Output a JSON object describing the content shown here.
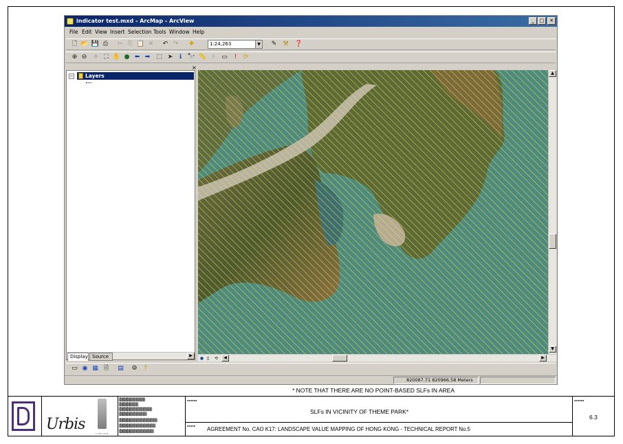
{
  "window": {
    "title": "indicator test.mxd - ArcMap - ArcView",
    "controls": [
      "_",
      "□",
      "✕"
    ]
  },
  "menu": [
    "File",
    "Edit",
    "View",
    "Insert",
    "Selection",
    "Tools",
    "Window",
    "Help"
  ],
  "toolbar_standard": {
    "icons": [
      "new-icon",
      "open-icon",
      "save-icon",
      "print-icon",
      "cut-icon",
      "copy-icon",
      "paste-icon",
      "delete-icon",
      "undo-icon",
      "redo-icon",
      "add-data-icon"
    ],
    "scale_value": "1:24,263",
    "extra_icons": [
      "editor-icon",
      "arctoolbox-icon",
      "whats-this-icon"
    ]
  },
  "toolbar_tools": {
    "icons": [
      "zoom-in-icon",
      "zoom-out-icon",
      "fixed-zoom-in-icon",
      "fixed-zoom-out-icon",
      "pan-icon",
      "full-extent-icon",
      "back-icon",
      "forward-icon",
      "select-features-icon",
      "select-elements-icon",
      "identify-icon",
      "find-icon",
      "measure-icon",
      "hyperlink-icon",
      "go-to-xy-icon",
      "alert-icon",
      "refresh-icon"
    ]
  },
  "toc": {
    "layers_label": "Layers",
    "tabs": [
      "Display",
      "Source"
    ]
  },
  "map": {
    "water_color": "#4e8b7c",
    "hatch_color": "#e6e060"
  },
  "status": {
    "coordinates": "820087.71  820966.58 Meters"
  },
  "note": "* NOTE THAT THERE ARE NO POINT-BASED SLFs IN AREA",
  "title_block": {
    "logo_text": "Urbis",
    "drawing_title": "SLFs IN VICINITY OF THEME PARK*",
    "agreement": "AGREEMENT No. CAO K17: LANDSCAPE VALUE MAPPING OF HONG KONG - TECHNICAL REPORT No.5",
    "figure_number": "6.3"
  }
}
